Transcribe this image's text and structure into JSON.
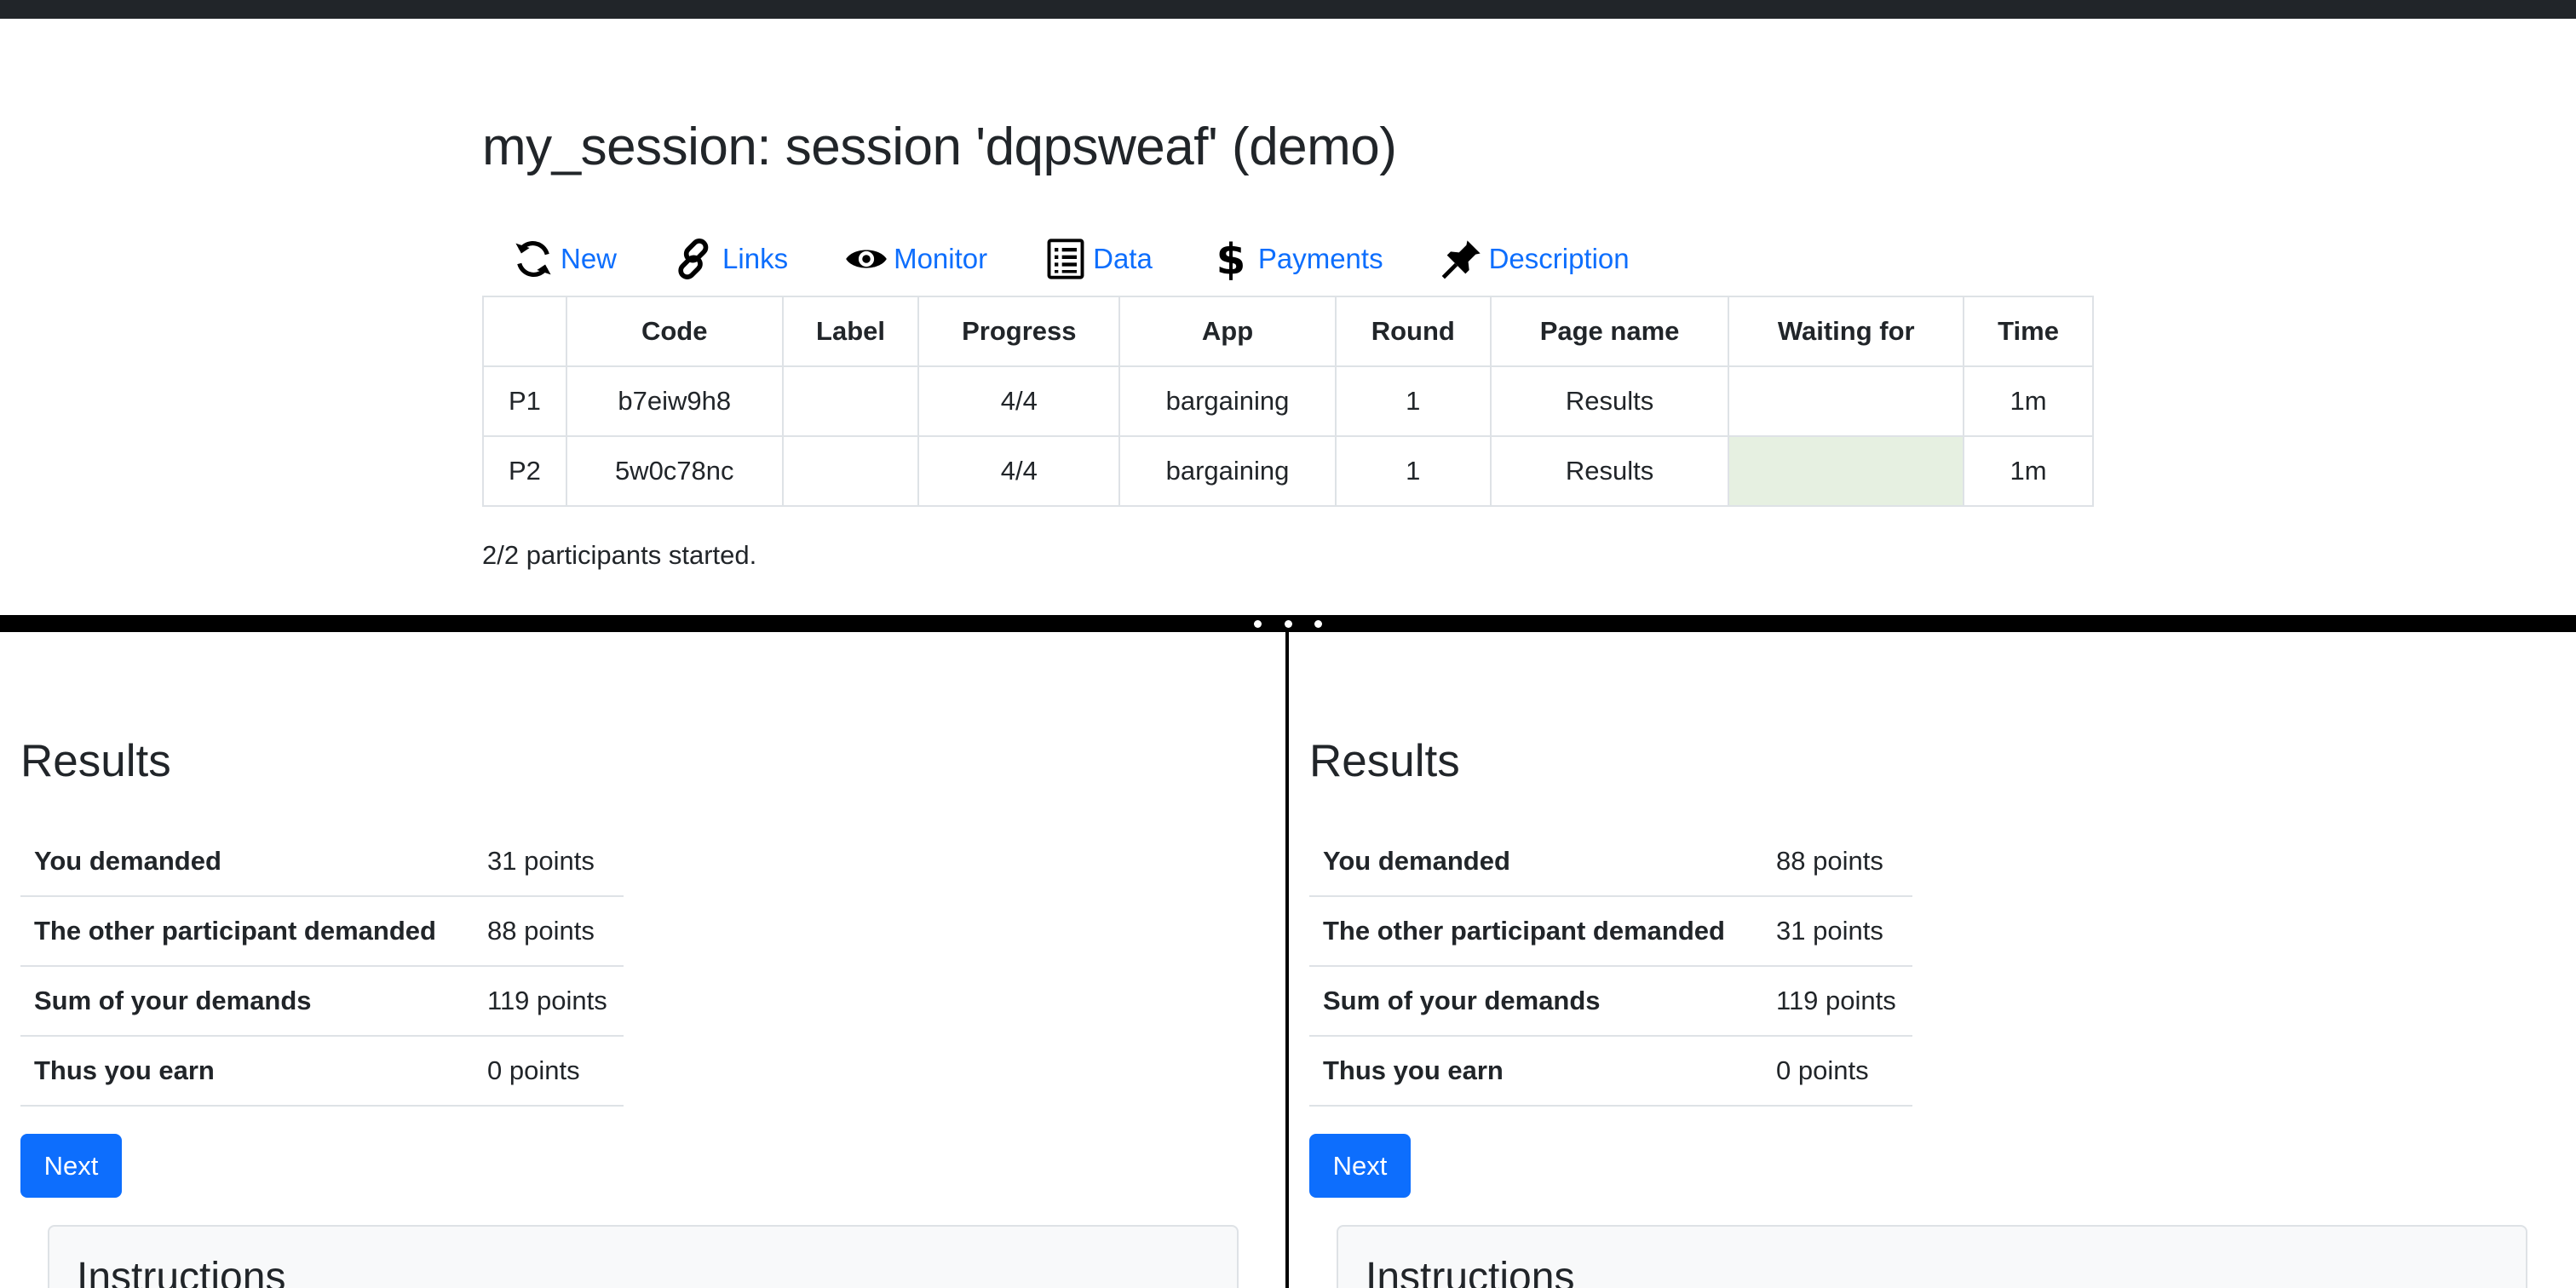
{
  "session": {
    "title": "my_session: session 'dqpsweaf' (demo)",
    "tabs": [
      {
        "label": "New",
        "icon": "refresh-icon"
      },
      {
        "label": "Links",
        "icon": "link-icon"
      },
      {
        "label": "Monitor",
        "icon": "eye-icon"
      },
      {
        "label": "Data",
        "icon": "list-icon"
      },
      {
        "label": "Payments",
        "icon": "dollar-icon"
      },
      {
        "label": "Description",
        "icon": "pin-icon"
      }
    ],
    "table": {
      "headers": [
        "",
        "Code",
        "Label",
        "Progress",
        "App",
        "Round",
        "Page name",
        "Waiting for",
        "Time"
      ],
      "rows": [
        [
          "P1",
          "b7eiw9h8",
          "",
          "4/4",
          "bargaining",
          "1",
          "Results",
          "",
          "1m"
        ],
        [
          "P2",
          "5w0c78nc",
          "",
          "4/4",
          "bargaining",
          "1",
          "Results",
          "",
          "1m"
        ]
      ]
    },
    "status": "2/2 participants started."
  },
  "colors": {
    "accent": "#0d6efd",
    "topbar": "#212529",
    "waiting_highlight": "#e6f0e1"
  },
  "panes": [
    {
      "heading": "Results",
      "rows": [
        {
          "label": "You demanded",
          "value": "31 points"
        },
        {
          "label": "The other participant demanded",
          "value": "88 points"
        },
        {
          "label": "Sum of your demands",
          "value": "119 points"
        },
        {
          "label": "Thus you earn",
          "value": "0 points"
        }
      ],
      "next_label": "Next",
      "instructions_heading": "Instructions"
    },
    {
      "heading": "Results",
      "rows": [
        {
          "label": "You demanded",
          "value": "88 points"
        },
        {
          "label": "The other participant demanded",
          "value": "31 points"
        },
        {
          "label": "Sum of your demands",
          "value": "119 points"
        },
        {
          "label": "Thus you earn",
          "value": "0 points"
        }
      ],
      "next_label": "Next",
      "instructions_heading": "Instructions"
    }
  ]
}
